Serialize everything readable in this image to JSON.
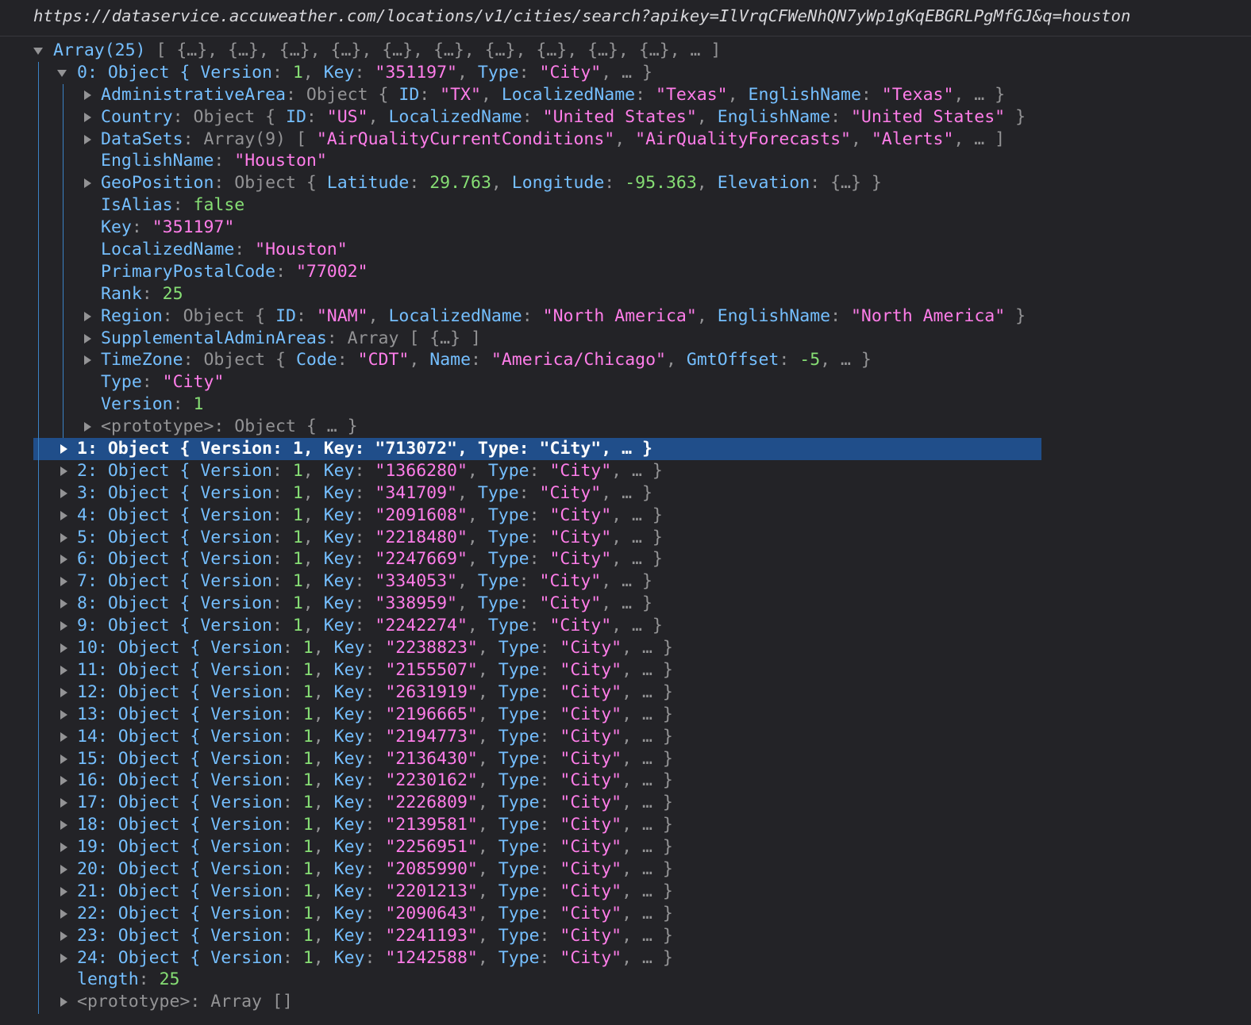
{
  "url": "https://dataservice.accuweather.com/locations/v1/cities/search?apikey=IlVrqCFWeNhQN7yWp1gKqEBGRLPgMfGJ&q=houston",
  "colors": {
    "background": "#232327",
    "key": "#75bfff",
    "number": "#86de74",
    "string": "#ff7de9",
    "punctuation": "#939395",
    "selection": "#204e8a",
    "guide": "#3b82c4"
  },
  "tree": {
    "root_label": "Array(25)",
    "root_preview": "[ {…}, {…}, {…}, {…}, {…}, {…}, {…}, {…}, {…}, {…}, … ]",
    "item0": {
      "header_index": "0",
      "header_type": "Object",
      "props": [
        {
          "key": "AdministrativeArea",
          "twisty": true,
          "preview": [
            [
              "p",
              "Object { "
            ],
            [
              "k",
              "ID"
            ],
            [
              "p",
              ": "
            ],
            [
              "s",
              "\"TX\""
            ],
            [
              "p",
              ", "
            ],
            [
              "k",
              "LocalizedName"
            ],
            [
              "p",
              ": "
            ],
            [
              "s",
              "\"Texas\""
            ],
            [
              "p",
              ", "
            ],
            [
              "k",
              "EnglishName"
            ],
            [
              "p",
              ": "
            ],
            [
              "s",
              "\"Texas\""
            ],
            [
              "p",
              ", … }"
            ]
          ]
        },
        {
          "key": "Country",
          "twisty": true,
          "preview": [
            [
              "p",
              "Object { "
            ],
            [
              "k",
              "ID"
            ],
            [
              "p",
              ": "
            ],
            [
              "s",
              "\"US\""
            ],
            [
              "p",
              ", "
            ],
            [
              "k",
              "LocalizedName"
            ],
            [
              "p",
              ": "
            ],
            [
              "s",
              "\"United States\""
            ],
            [
              "p",
              ", "
            ],
            [
              "k",
              "EnglishName"
            ],
            [
              "p",
              ": "
            ],
            [
              "s",
              "\"United States\""
            ],
            [
              "p",
              " }"
            ]
          ]
        },
        {
          "key": "DataSets",
          "twisty": true,
          "preview": [
            [
              "p",
              "Array(9) [ "
            ],
            [
              "s",
              "\"AirQualityCurrentConditions\""
            ],
            [
              "p",
              ", "
            ],
            [
              "s",
              "\"AirQualityForecasts\""
            ],
            [
              "p",
              ", "
            ],
            [
              "s",
              "\"Alerts\""
            ],
            [
              "p",
              ", … ]"
            ]
          ]
        },
        {
          "key": "EnglishName",
          "twisty": false,
          "preview": [
            [
              "s",
              "\"Houston\""
            ]
          ]
        },
        {
          "key": "GeoPosition",
          "twisty": true,
          "preview": [
            [
              "p",
              "Object { "
            ],
            [
              "k",
              "Latitude"
            ],
            [
              "p",
              ": "
            ],
            [
              "n",
              "29.763"
            ],
            [
              "p",
              ", "
            ],
            [
              "k",
              "Longitude"
            ],
            [
              "p",
              ": "
            ],
            [
              "n",
              "-95.363"
            ],
            [
              "p",
              ", "
            ],
            [
              "k",
              "Elevation"
            ],
            [
              "p",
              ": {…} }"
            ]
          ]
        },
        {
          "key": "IsAlias",
          "twisty": false,
          "preview": [
            [
              "n",
              "false"
            ]
          ]
        },
        {
          "key": "Key",
          "twisty": false,
          "preview": [
            [
              "s",
              "\"351197\""
            ]
          ]
        },
        {
          "key": "LocalizedName",
          "twisty": false,
          "preview": [
            [
              "s",
              "\"Houston\""
            ]
          ]
        },
        {
          "key": "PrimaryPostalCode",
          "twisty": false,
          "preview": [
            [
              "s",
              "\"77002\""
            ]
          ]
        },
        {
          "key": "Rank",
          "twisty": false,
          "preview": [
            [
              "n",
              "25"
            ]
          ]
        },
        {
          "key": "Region",
          "twisty": true,
          "preview": [
            [
              "p",
              "Object { "
            ],
            [
              "k",
              "ID"
            ],
            [
              "p",
              ": "
            ],
            [
              "s",
              "\"NAM\""
            ],
            [
              "p",
              ", "
            ],
            [
              "k",
              "LocalizedName"
            ],
            [
              "p",
              ": "
            ],
            [
              "s",
              "\"North America\""
            ],
            [
              "p",
              ", "
            ],
            [
              "k",
              "EnglishName"
            ],
            [
              "p",
              ": "
            ],
            [
              "s",
              "\"North America\""
            ],
            [
              "p",
              " }"
            ]
          ]
        },
        {
          "key": "SupplementalAdminAreas",
          "twisty": true,
          "preview": [
            [
              "p",
              "Array [ {…} ]"
            ]
          ]
        },
        {
          "key": "TimeZone",
          "twisty": true,
          "preview": [
            [
              "p",
              "Object { "
            ],
            [
              "k",
              "Code"
            ],
            [
              "p",
              ": "
            ],
            [
              "s",
              "\"CDT\""
            ],
            [
              "p",
              ", "
            ],
            [
              "k",
              "Name"
            ],
            [
              "p",
              ": "
            ],
            [
              "s",
              "\"America/Chicago\""
            ],
            [
              "p",
              ", "
            ],
            [
              "k",
              "GmtOffset"
            ],
            [
              "p",
              ": "
            ],
            [
              "n",
              "-5"
            ],
            [
              "p",
              ", … }"
            ]
          ]
        },
        {
          "key": "Type",
          "twisty": false,
          "preview": [
            [
              "s",
              "\"City\""
            ]
          ]
        },
        {
          "key": "Version",
          "twisty": false,
          "preview": [
            [
              "n",
              "1"
            ]
          ]
        },
        {
          "key": "<prototype>",
          "twisty": true,
          "proto": true,
          "preview": [
            [
              "p",
              "Object { … }"
            ]
          ]
        }
      ]
    },
    "items": [
      {
        "index": "0",
        "version": "1",
        "key": "351197",
        "type": "City"
      },
      {
        "index": "1",
        "version": "1",
        "key": "713072",
        "type": "City"
      },
      {
        "index": "2",
        "version": "1",
        "key": "1366280",
        "type": "City"
      },
      {
        "index": "3",
        "version": "1",
        "key": "341709",
        "type": "City"
      },
      {
        "index": "4",
        "version": "1",
        "key": "2091608",
        "type": "City"
      },
      {
        "index": "5",
        "version": "1",
        "key": "2218480",
        "type": "City"
      },
      {
        "index": "6",
        "version": "1",
        "key": "2247669",
        "type": "City"
      },
      {
        "index": "7",
        "version": "1",
        "key": "334053",
        "type": "City"
      },
      {
        "index": "8",
        "version": "1",
        "key": "338959",
        "type": "City"
      },
      {
        "index": "9",
        "version": "1",
        "key": "2242274",
        "type": "City"
      },
      {
        "index": "10",
        "version": "1",
        "key": "2238823",
        "type": "City"
      },
      {
        "index": "11",
        "version": "1",
        "key": "2155507",
        "type": "City"
      },
      {
        "index": "12",
        "version": "1",
        "key": "2631919",
        "type": "City"
      },
      {
        "index": "13",
        "version": "1",
        "key": "2196665",
        "type": "City"
      },
      {
        "index": "14",
        "version": "1",
        "key": "2194773",
        "type": "City"
      },
      {
        "index": "15",
        "version": "1",
        "key": "2136430",
        "type": "City"
      },
      {
        "index": "16",
        "version": "1",
        "key": "2230162",
        "type": "City"
      },
      {
        "index": "17",
        "version": "1",
        "key": "2226809",
        "type": "City"
      },
      {
        "index": "18",
        "version": "1",
        "key": "2139581",
        "type": "City"
      },
      {
        "index": "19",
        "version": "1",
        "key": "2256951",
        "type": "City"
      },
      {
        "index": "20",
        "version": "1",
        "key": "2085990",
        "type": "City"
      },
      {
        "index": "21",
        "version": "1",
        "key": "2201213",
        "type": "City"
      },
      {
        "index": "22",
        "version": "1",
        "key": "2090643",
        "type": "City"
      },
      {
        "index": "23",
        "version": "1",
        "key": "2241193",
        "type": "City"
      },
      {
        "index": "24",
        "version": "1",
        "key": "1242588",
        "type": "City"
      }
    ],
    "selected_index": "1",
    "length_label": "length",
    "length_value": "25",
    "array_proto_key": "<prototype>",
    "array_proto_value": "Array []"
  }
}
